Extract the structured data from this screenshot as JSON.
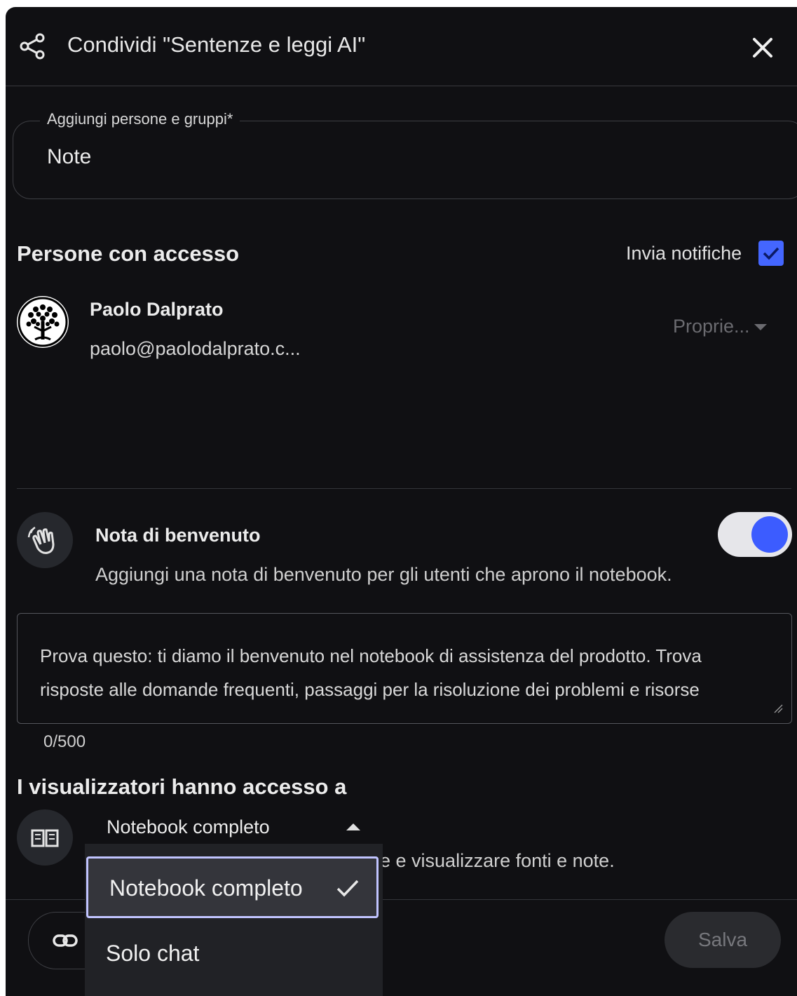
{
  "dialog": {
    "title": "Condividi \"Sentenze e leggi AI\""
  },
  "add_people": {
    "label": "Aggiungi persone e gruppi*",
    "value": "Note"
  },
  "access": {
    "title": "Persone con accesso",
    "notify_label": "Invia notifiche",
    "notify_checked": true,
    "person": {
      "name": "Paolo Dalprato",
      "email": "paolo@paolodalprato.c...",
      "role": "Proprie..."
    }
  },
  "welcome": {
    "title": "Nota di benvenuto",
    "description": "Aggiungi una nota di benvenuto per gli utenti che aprono il notebook.",
    "enabled": true,
    "note_text": "Prova questo: ti diamo il benvenuto nel notebook di assistenza del prodotto. Trova\nrisposte alle domande frequenti, passaggi per la risoluzione dei problemi e risorse",
    "counter": "0/500"
  },
  "viewers": {
    "title": "I visualizzatori hanno accesso a",
    "selected": "Notebook completo",
    "description_visible": "e e visualizzare fonti e note.",
    "options": [
      {
        "label": "Notebook completo",
        "selected": true
      },
      {
        "label": "Solo chat",
        "selected": false
      }
    ]
  },
  "footer": {
    "save_label": "Salva"
  },
  "colors": {
    "background": "#101013",
    "accent": "#3c5cff",
    "checkbox": "#4466ff",
    "menu_bg": "#212226",
    "menu_selected_border": "#c1c4ff"
  },
  "icons": [
    "share-icon",
    "close-icon",
    "avatar-tree-icon",
    "waving-hand-icon",
    "book-icon",
    "link-icon",
    "checkmark-icon"
  ]
}
